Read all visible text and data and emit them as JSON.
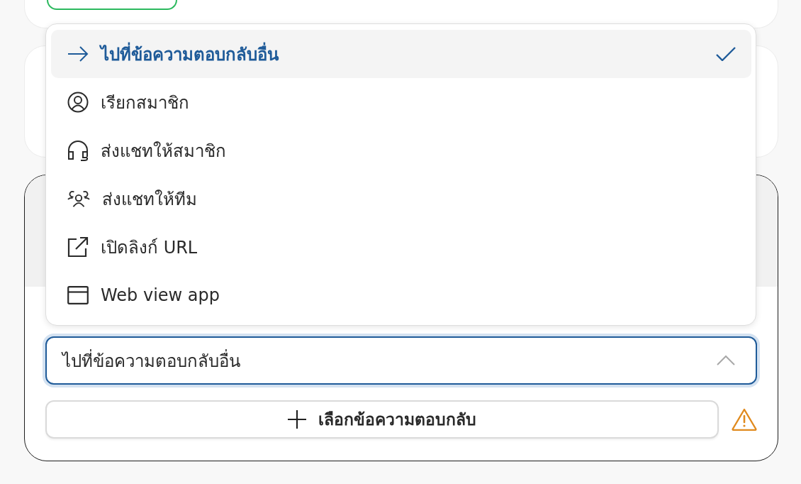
{
  "dropdown_menu": {
    "items": [
      {
        "kind": "goto",
        "label": "ไปที่ข้อความตอบกลับอื่น",
        "selected": true
      },
      {
        "kind": "call",
        "label": "เรียกสมาชิก",
        "selected": false
      },
      {
        "kind": "chat-member",
        "label": "ส่งแชทให้สมาชิก",
        "selected": false
      },
      {
        "kind": "chat-team",
        "label": "ส่งแชทให้ทีม",
        "selected": false
      },
      {
        "kind": "link",
        "label": "เปิดลิงก์ URL",
        "selected": false
      },
      {
        "kind": "webview",
        "label": "Web view app",
        "selected": false
      }
    ]
  },
  "action_select": {
    "value": "ไปที่ข้อความตอบกลับอื่น",
    "expanded": true
  },
  "choose_reply_button": {
    "label": "เลือกข้อความตอบกลับ",
    "warning": true
  }
}
